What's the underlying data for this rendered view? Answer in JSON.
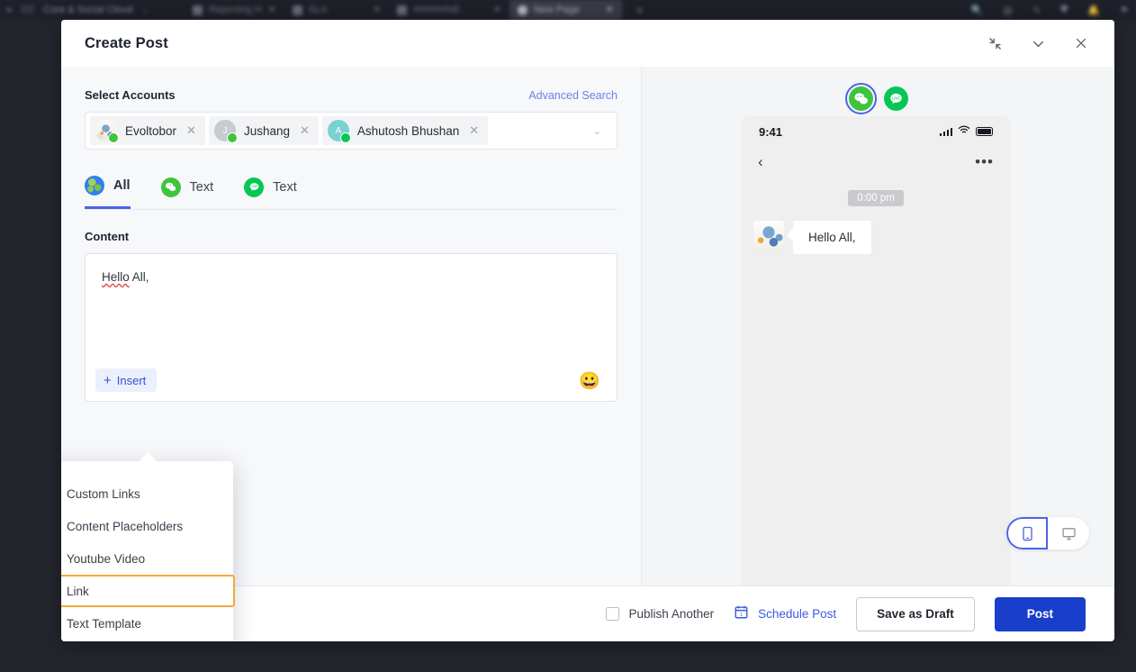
{
  "browser": {
    "app_name": "Core & Social Cloud",
    "tabs": [
      {
        "label": "Reporting H",
        "icon": "chart-icon",
        "active": false
      },
      {
        "label": "SLA",
        "icon": "chart-icon",
        "active": false
      },
      {
        "label": "######NE",
        "icon": "chat-icon",
        "active": false
      },
      {
        "label": "New Page",
        "icon": "page-icon",
        "active": true
      }
    ],
    "new_tab_label": "+",
    "toolbar_icons": [
      "search-icon",
      "calendar-icon",
      "pencil-icon",
      "shield-icon",
      "bell-icon",
      "flag-icon"
    ]
  },
  "modal": {
    "title": "Create Post",
    "header_actions": [
      {
        "name": "collapse-icon",
        "glyph": "⤡"
      },
      {
        "name": "chevron-down-icon",
        "glyph": "⌄"
      },
      {
        "name": "close-icon",
        "glyph": "✕"
      }
    ]
  },
  "accounts": {
    "label": "Select Accounts",
    "advanced_search": "Advanced Search",
    "chips": [
      {
        "name": "Evoltobor",
        "avatar_type": "photo",
        "avatar_initial": "",
        "badge": "wechat",
        "remove": "✕"
      },
      {
        "name": "Jushang",
        "avatar_type": "initial",
        "avatar_initial": "J",
        "badge": "wechat",
        "remove": "✕"
      },
      {
        "name": "Ashutosh Bhushan",
        "avatar_type": "initial",
        "avatar_initial": "A",
        "badge": "line",
        "remove": "✕"
      }
    ],
    "caret": "⌄"
  },
  "tabs": [
    {
      "label": "All",
      "icon": "globe-icon",
      "active": true
    },
    {
      "label": "Text",
      "icon": "wechat-icon",
      "active": false
    },
    {
      "label": "Text",
      "icon": "line-icon",
      "active": false
    }
  ],
  "content": {
    "label": "Content",
    "text": "Hello All,",
    "spellcheck_word": "Hello",
    "rest_text": " All,",
    "insert_label": "Insert",
    "insert_plus": "+",
    "emoji": "😀"
  },
  "insert_menu": {
    "items": [
      {
        "label": "Custom Links",
        "icon": "chain-link-icon",
        "selected": false
      },
      {
        "label": "Content Placeholders",
        "icon": "placeholder-icon",
        "selected": false
      },
      {
        "label": "Youtube Video",
        "icon": "paperclip-icon",
        "selected": false
      },
      {
        "label": "Link",
        "icon": "paperclip-icon",
        "selected": true
      },
      {
        "label": "Text Template",
        "icon": "document-icon",
        "selected": false
      }
    ],
    "highlight_color": "#f0ab3a"
  },
  "preview": {
    "channels": [
      {
        "name": "wechat-icon",
        "active": true
      },
      {
        "name": "line-icon",
        "active": false
      }
    ],
    "phone": {
      "status_time": "9:41",
      "back": "‹",
      "more": "•••",
      "timestamp": "0:00 pm",
      "message": "Hello All,"
    },
    "device_toggle": [
      {
        "name": "mobile-icon",
        "active": true
      },
      {
        "name": "desktop-icon",
        "active": false
      }
    ]
  },
  "footer": {
    "publish_another": "Publish Another",
    "schedule_post": "Schedule Post",
    "save_draft": "Save as Draft",
    "post": "Post"
  },
  "colors": {
    "accent_blue": "#4a63e7",
    "post_blue": "#1a3ecc",
    "link_blue": "#3a5ae0",
    "highlight_orange": "#f0ab3a",
    "wechat_green": "#3ec43e",
    "line_green": "#06c755"
  }
}
